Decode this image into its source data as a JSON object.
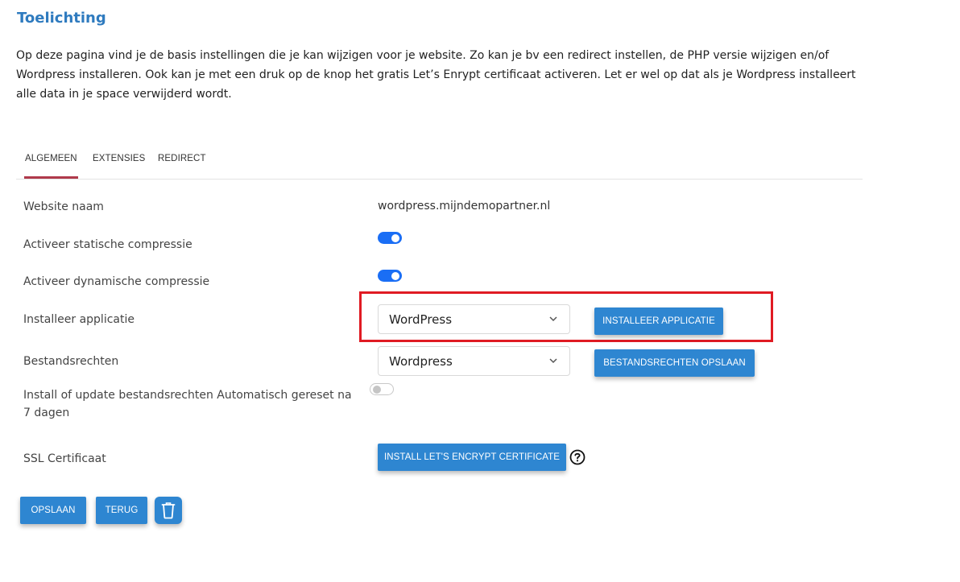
{
  "header": {
    "title": "Toelichting",
    "intro": "Op deze pagina vind je de basis instellingen die je kan wijzigen voor je website. Zo kan je bv een redirect instellen, de PHP versie wijzigen en/of Wordpress installeren. Ook kan je met een druk op de knop het gratis Let’s Enrypt certificaat activeren. Let er wel op dat als je Wordpress installeert alle data in je space verwijderd wordt."
  },
  "tabs": [
    {
      "label": "ALGEMEEN",
      "active": true
    },
    {
      "label": "EXTENSIES",
      "active": false
    },
    {
      "label": "REDIRECT",
      "active": false
    }
  ],
  "form": {
    "website_name": {
      "label": "Website naam",
      "value": "wordpress.mijndemopartner.nl"
    },
    "static_compression": {
      "label": "Activeer statische compressie",
      "enabled": true
    },
    "dynamic_compression": {
      "label": "Activeer dynamische compressie",
      "enabled": true
    },
    "install_app": {
      "label": "Installeer applicatie",
      "selected": "WordPress",
      "button": "INSTALLEER APPLICATIE"
    },
    "file_permissions": {
      "label": "Bestandsrechten",
      "selected": "Wordpress",
      "button": "BESTANDSRECHTEN OPSLAAN"
    },
    "auto_reset": {
      "label": "Install of update bestandsrechten Automatisch gereset na 7 dagen",
      "enabled": false
    },
    "ssl": {
      "label": "SSL Certificaat",
      "button": "INSTALL LET'S ENCRYPT CERTIFICATE",
      "help_icon": "question-circle-icon"
    }
  },
  "actions": {
    "save": "OPSLAAN",
    "back": "TERUG",
    "delete_icon": "trash-icon"
  },
  "colors": {
    "accent": "#2e86d1",
    "title": "#2f7bbf",
    "toggle_on": "#1a6ef5",
    "tab_indicator": "#b03a4b",
    "highlight": "#e01b23"
  }
}
